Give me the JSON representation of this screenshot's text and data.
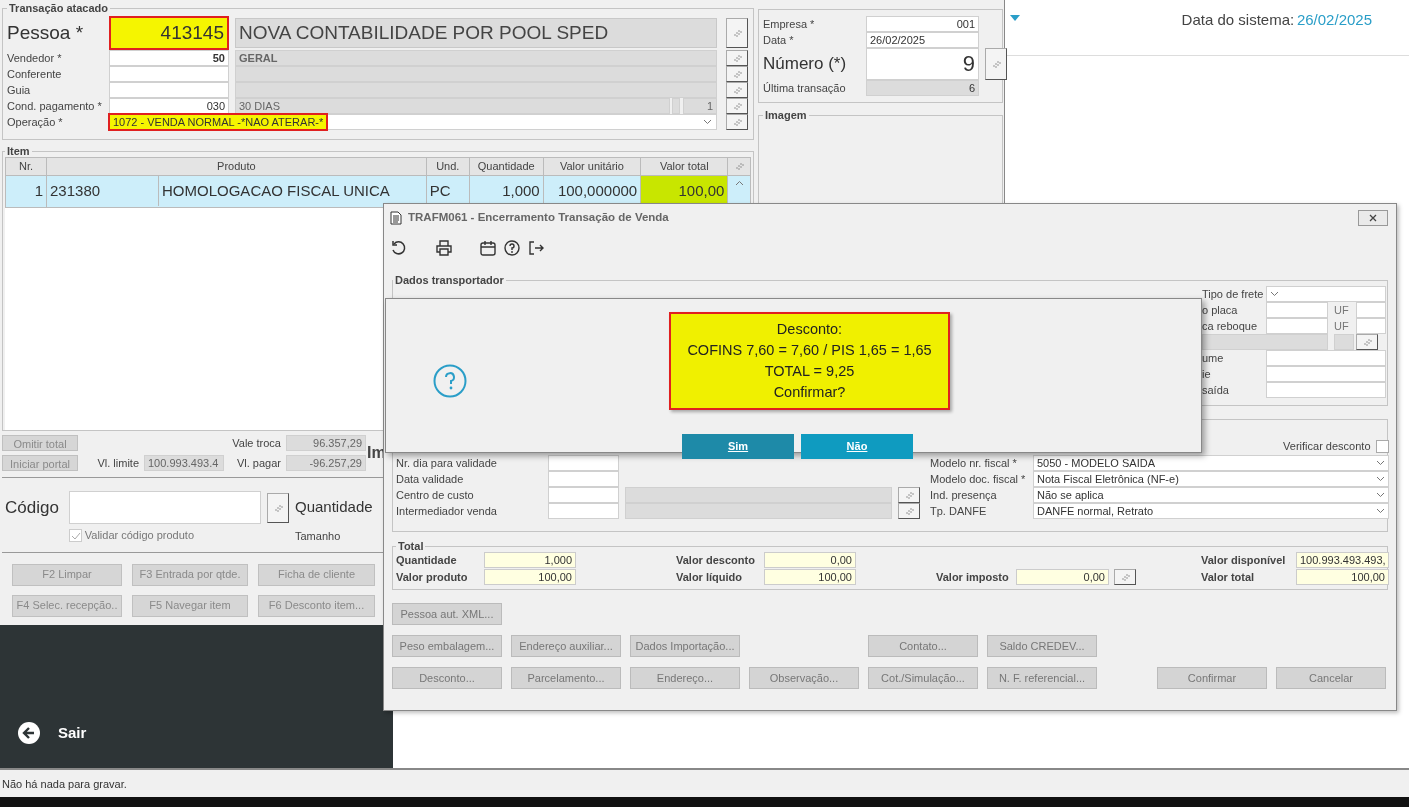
{
  "system_header": {
    "label": "Data do sistema:",
    "date": "26/02/2025"
  },
  "main_form": {
    "title": "Transação atacado",
    "pessoa": {
      "label": "Pessoa *",
      "code": "413145",
      "name": "NOVA CONTABILIDADE POR POOL SPED"
    },
    "fields": [
      {
        "label": "Vendedor *",
        "code": "50",
        "description": "GERAL"
      },
      {
        "label": "Conferente"
      },
      {
        "label": "Guia"
      },
      {
        "label": "Cond. pagamento *",
        "code": "030",
        "description": "30 DIAS",
        "extra": "1"
      }
    ],
    "operacao": {
      "label": "Operação *",
      "value": "1072 - VENDA NORMAL -*NAO ATERAR-*"
    },
    "empresa": [
      {
        "label": "Empresa *",
        "value": "001"
      },
      {
        "label": "Data *",
        "value": "26/02/2025"
      }
    ],
    "numero": {
      "label": "Número (*)",
      "value": "9"
    },
    "ultima": {
      "label": "Última transação",
      "value": "6"
    },
    "imagem_title": "Imagem",
    "item": {
      "title": "Item",
      "columns": [
        "Nr.",
        "Produto",
        "Und.",
        "Quantidade",
        "Valor unitário",
        "Valor total"
      ],
      "rows": [
        {
          "nr": "1",
          "product_code": "231380",
          "product_name": "HOMOLOGACAO FISCAL UNICA",
          "unit": "PC",
          "quantity": "1,000",
          "unit_price": "100,000000",
          "total": "100,00",
          "selected": true
        }
      ]
    },
    "totals": {
      "buttons": [
        "Omitir total",
        "Iniciar portal"
      ],
      "limit_label": "Vl. limite",
      "limit_value": "100.993.493.4",
      "vale_label": "Vale troca",
      "vale_value": "96.357,29",
      "pagar_label": "Vl. pagar",
      "pagar_value": "-96.257,29",
      "cut_heading": "Im"
    },
    "codigo": {
      "label": "Código",
      "check_label": "Validar código produto",
      "checked": true,
      "quantity_label": "Quantidade",
      "size_label": "Tamanho"
    },
    "function_buttons": [
      "F2 Limpar",
      "F3 Entrada por qtde.",
      "Ficha de cliente",
      "F4 Selec. recepção..",
      "F5 Navegar item",
      "F6 Desconto item..."
    ],
    "exit_label": "Sair"
  },
  "status_bar": "Não há nada para gravar.",
  "dialog": {
    "title": "TRAFM061 - Encerramento Transação de Venda",
    "transport": {
      "title": "Dados transportador",
      "rows": [
        {
          "kind": "select",
          "label": "Tipo de frete"
        },
        {
          "kind": "uf",
          "label": "o placa",
          "uf": "UF"
        },
        {
          "kind": "uf",
          "label": "ca reboque",
          "uf": "UF"
        },
        {
          "kind": "lookup"
        },
        {
          "kind": "input",
          "label": "ume"
        },
        {
          "kind": "input",
          "label": "ie"
        },
        {
          "kind": "input",
          "label": "saída"
        }
      ]
    },
    "details": {
      "check_label": "Verificar desconto",
      "checked": false,
      "left": [
        {
          "kind": "input",
          "label": "Nr. dia para validade"
        },
        {
          "kind": "input",
          "label": "Data validade"
        },
        {
          "kind": "lookup",
          "label": "Centro de custo"
        },
        {
          "kind": "lookup",
          "label": "Intermediador venda"
        }
      ],
      "right": [
        {
          "label": "Modelo nr. fiscal *",
          "value": "5050 - MODELO SAIDA"
        },
        {
          "label": "Modelo doc. fiscal *",
          "value": "Nota Fiscal Eletrônica (NF-e)"
        },
        {
          "label": "Ind. presença",
          "value": "Não se aplica"
        },
        {
          "label": "Tp. DANFE",
          "value": "DANFE normal, Retrato"
        }
      ]
    },
    "total": {
      "title": "Total",
      "quantidade": {
        "label": "Quantidade",
        "value": "1,000"
      },
      "produto": {
        "label": "Valor produto",
        "value": "100,00"
      },
      "desconto": {
        "label": "Valor desconto",
        "value": "0,00"
      },
      "liquido": {
        "label": "Valor líquido",
        "value": "100,00"
      },
      "imposto": {
        "label": "Valor imposto",
        "value": "0,00"
      },
      "disponivel": {
        "label": "Valor disponível",
        "value": "100.993.493.493,"
      },
      "total": {
        "label": "Valor total",
        "value": "100,00"
      }
    },
    "button_rows": [
      {
        "left": [
          "Pessoa aut. XML..."
        ]
      },
      {
        "left": [
          "Peso embalagem...",
          "Endereço auxiliar...",
          "Dados Importação..."
        ],
        "middle": [
          "Contato...",
          "Saldo CREDEV..."
        ]
      },
      {
        "left": [
          "Desconto...",
          "Parcelamento...",
          "Endereço...",
          "Observação...",
          "Cot./Simulação...",
          "N. F. referencial..."
        ],
        "right": [
          "Confirmar",
          "Cancelar"
        ]
      }
    ]
  },
  "message": {
    "lines": [
      "Desconto:",
      "COFINS 7,60 = 7,60 / PIS 1,65 = 1,65",
      "TOTAL = 9,25",
      "Confirmar?"
    ],
    "buttons": [
      {
        "label": "Sim",
        "kind": "primary"
      },
      {
        "label": "Não",
        "kind": "secondary"
      }
    ]
  }
}
